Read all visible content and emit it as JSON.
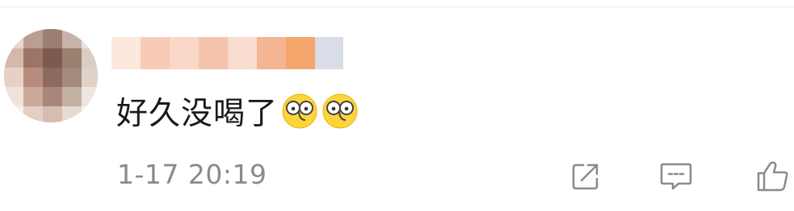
{
  "comment": {
    "text": "好久没喝了",
    "emojis": [
      "glasses-emoji",
      "glasses-emoji"
    ],
    "timestamp": "1-17 20:19"
  },
  "icons": {
    "share": "share-icon",
    "reply": "comment-icon",
    "like": "thumbs-up-icon"
  },
  "colors": {
    "text": "#1a1a1a",
    "muted": "#8a8a8a",
    "icon": "#8a8a8a",
    "emoji_yellow": "#ffd43b"
  }
}
